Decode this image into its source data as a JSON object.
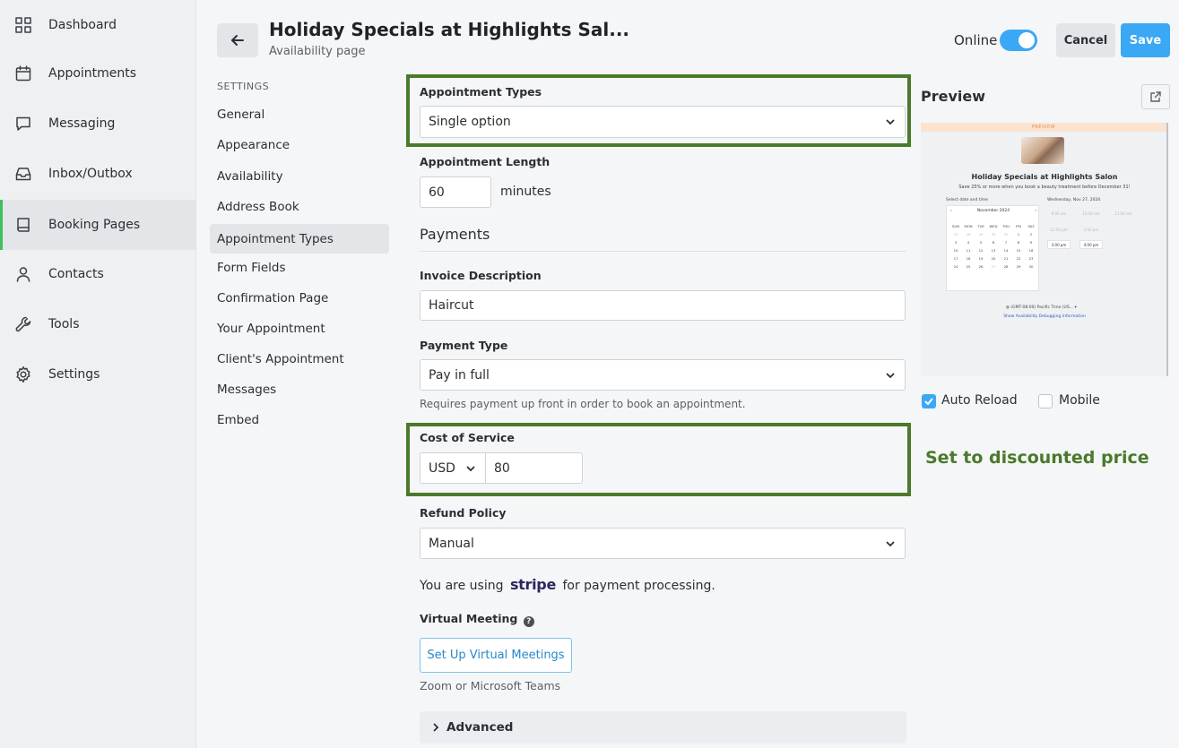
{
  "nav": {
    "items": [
      {
        "label": "Dashboard",
        "icon": "grid-icon"
      },
      {
        "label": "Appointments",
        "icon": "calendar-icon"
      },
      {
        "label": "Messaging",
        "icon": "chat-icon"
      },
      {
        "label": "Inbox/Outbox",
        "icon": "inbox-icon"
      },
      {
        "label": "Booking Pages",
        "icon": "book-icon",
        "active": true
      },
      {
        "label": "Contacts",
        "icon": "person-icon"
      },
      {
        "label": "Tools",
        "icon": "wrench-icon"
      },
      {
        "label": "Settings",
        "icon": "gear-icon"
      }
    ]
  },
  "header": {
    "title": "Holiday Specials at Highlights Sal...",
    "subtitle": "Availability page",
    "online_label": "Online",
    "online_on": true,
    "cancel_label": "Cancel",
    "save_label": "Save"
  },
  "settings_nav": {
    "heading": "SETTINGS",
    "items": [
      "General",
      "Appearance",
      "Availability",
      "Address Book",
      "Appointment Types",
      "Form Fields",
      "Confirmation Page",
      "Your Appointment",
      "Client's Appointment",
      "Messages",
      "Embed"
    ],
    "active": "Appointment Types"
  },
  "form": {
    "appointment_types": {
      "label": "Appointment Types",
      "value": "Single option"
    },
    "appointment_length": {
      "label": "Appointment Length",
      "value": "60",
      "unit": "minutes"
    },
    "payments_heading": "Payments",
    "invoice_description": {
      "label": "Invoice Description",
      "value": "Haircut"
    },
    "payment_type": {
      "label": "Payment Type",
      "value": "Pay in full",
      "helper": "Requires payment up front in order to book an appointment."
    },
    "cost_of_service": {
      "label": "Cost of Service",
      "currency": "USD",
      "value": "80"
    },
    "refund_policy": {
      "label": "Refund Policy",
      "value": "Manual"
    },
    "stripe": {
      "prefix": "You are using",
      "logo": "stripe",
      "suffix": "for payment processing."
    },
    "virtual_meeting": {
      "label": "Virtual Meeting",
      "help": "?",
      "button": "Set Up Virtual Meetings",
      "helper": "Zoom or Microsoft Teams"
    },
    "advanced_label": "Advanced"
  },
  "annotation": {
    "text": "Set to discounted price",
    "color": "#4a7a2a"
  },
  "preview": {
    "title": "Preview",
    "banner": "PREVIEW",
    "page_title": "Holiday Specials at Highlights Salon",
    "page_sub": "Save 25% or more when you book a beauty treatment before December 31!",
    "select_label": "Select date and time",
    "date_label": "Wednesday, Nov 27, 2024",
    "month": "November 2024",
    "weekdays": [
      "SUN",
      "MON",
      "TUE",
      "WED",
      "THU",
      "FRI",
      "SAT"
    ],
    "days": [
      {
        "d": "27",
        "m": true
      },
      {
        "d": "28",
        "m": true
      },
      {
        "d": "29",
        "m": true
      },
      {
        "d": "30",
        "m": true
      },
      {
        "d": "31",
        "m": true
      },
      {
        "d": "1"
      },
      {
        "d": "2"
      },
      {
        "d": "3"
      },
      {
        "d": "4"
      },
      {
        "d": "5"
      },
      {
        "d": "6"
      },
      {
        "d": "7"
      },
      {
        "d": "8"
      },
      {
        "d": "9"
      },
      {
        "d": "10"
      },
      {
        "d": "11"
      },
      {
        "d": "12"
      },
      {
        "d": "13"
      },
      {
        "d": "14"
      },
      {
        "d": "15"
      },
      {
        "d": "16"
      },
      {
        "d": "17"
      },
      {
        "d": "18"
      },
      {
        "d": "19"
      },
      {
        "d": "20"
      },
      {
        "d": "21"
      },
      {
        "d": "22"
      },
      {
        "d": "23"
      },
      {
        "d": "24"
      },
      {
        "d": "25"
      },
      {
        "d": "26"
      },
      {
        "d": "27",
        "m": true
      },
      {
        "d": "28"
      },
      {
        "d": "29"
      },
      {
        "d": "30"
      }
    ],
    "slots": [
      {
        "t": "9:00 am"
      },
      {
        "t": "10:00 am"
      },
      {
        "t": "11:00 am"
      },
      {
        "t": "12:00 pm"
      },
      {
        "t": "1:00 pm"
      },
      {
        "t": "3:00 pm",
        "on": true
      },
      {
        "t": "4:00 pm",
        "on": true
      }
    ],
    "timezone": "(GMT-08:00) Pacific Time (US...",
    "debug_link": "Show Availability Debugging Information",
    "auto_reload": {
      "label": "Auto Reload",
      "checked": true
    },
    "mobile": {
      "label": "Mobile",
      "checked": false
    }
  },
  "colors": {
    "accent": "#3aa8f5",
    "active_nav": "#3fbf5e",
    "highlight": "#4a7a2a"
  }
}
